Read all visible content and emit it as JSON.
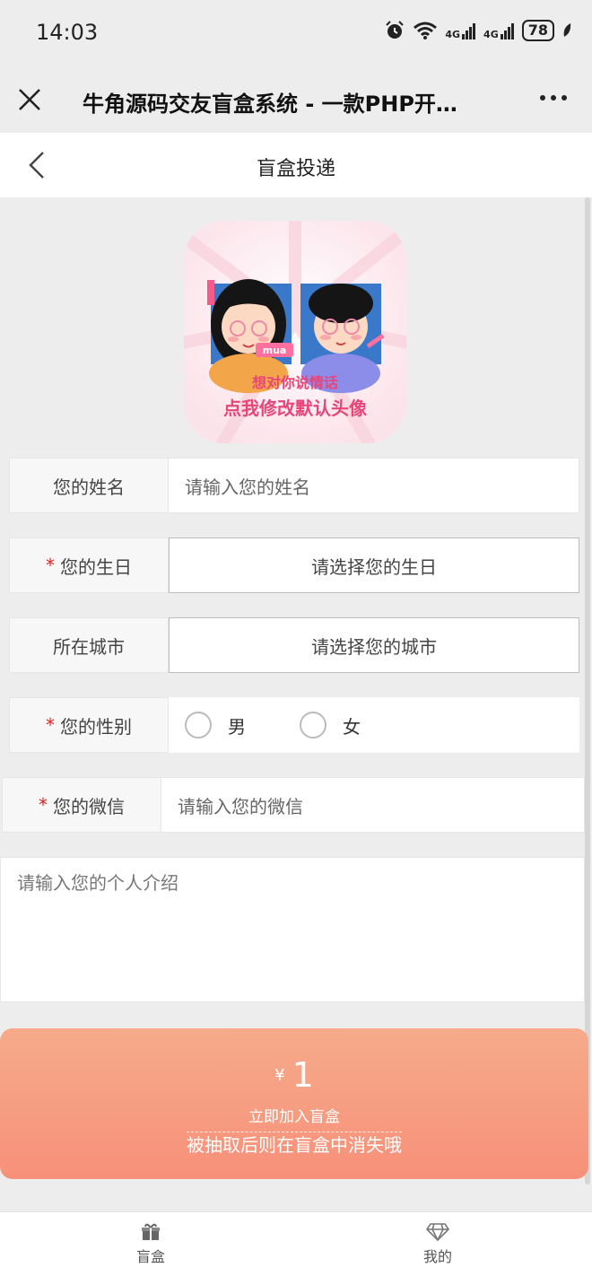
{
  "status": {
    "time": "14:03",
    "net1": "4G",
    "net2": "4G",
    "battery": "78"
  },
  "titlebar": {
    "title": "牛角源码交友盲盒系统 - 一款PHP开…"
  },
  "nav": {
    "title": "盲盒投递"
  },
  "avatar": {
    "line1": "想对你说情话",
    "line2": "点我修改默认头像",
    "tag": "mua"
  },
  "form": {
    "name": {
      "label": "您的姓名",
      "placeholder": "请输入您的姓名"
    },
    "birthday": {
      "required": "*",
      "label": "您的生日",
      "placeholder": "请选择您的生日"
    },
    "city": {
      "label": "所在城市",
      "placeholder": "请选择您的城市"
    },
    "gender": {
      "required": "*",
      "label": "您的性别",
      "male": "男",
      "female": "女"
    },
    "wechat": {
      "required": "*",
      "label": "您的微信",
      "placeholder": "请输入您的微信"
    },
    "intro": {
      "placeholder": "请输入您的个人介绍"
    }
  },
  "submit": {
    "currency": "¥",
    "price": "1",
    "label": "立即加入盲盒",
    "note": "被抽取后则在盲盒中消失哦"
  },
  "tabs": [
    {
      "label": "盲盒",
      "icon": "gift-icon"
    },
    {
      "label": "我的",
      "icon": "diamond-icon"
    }
  ],
  "colors": {
    "button_top": "#f6ab8a",
    "button_bottom": "#f7907a",
    "required": "#dd2222"
  }
}
